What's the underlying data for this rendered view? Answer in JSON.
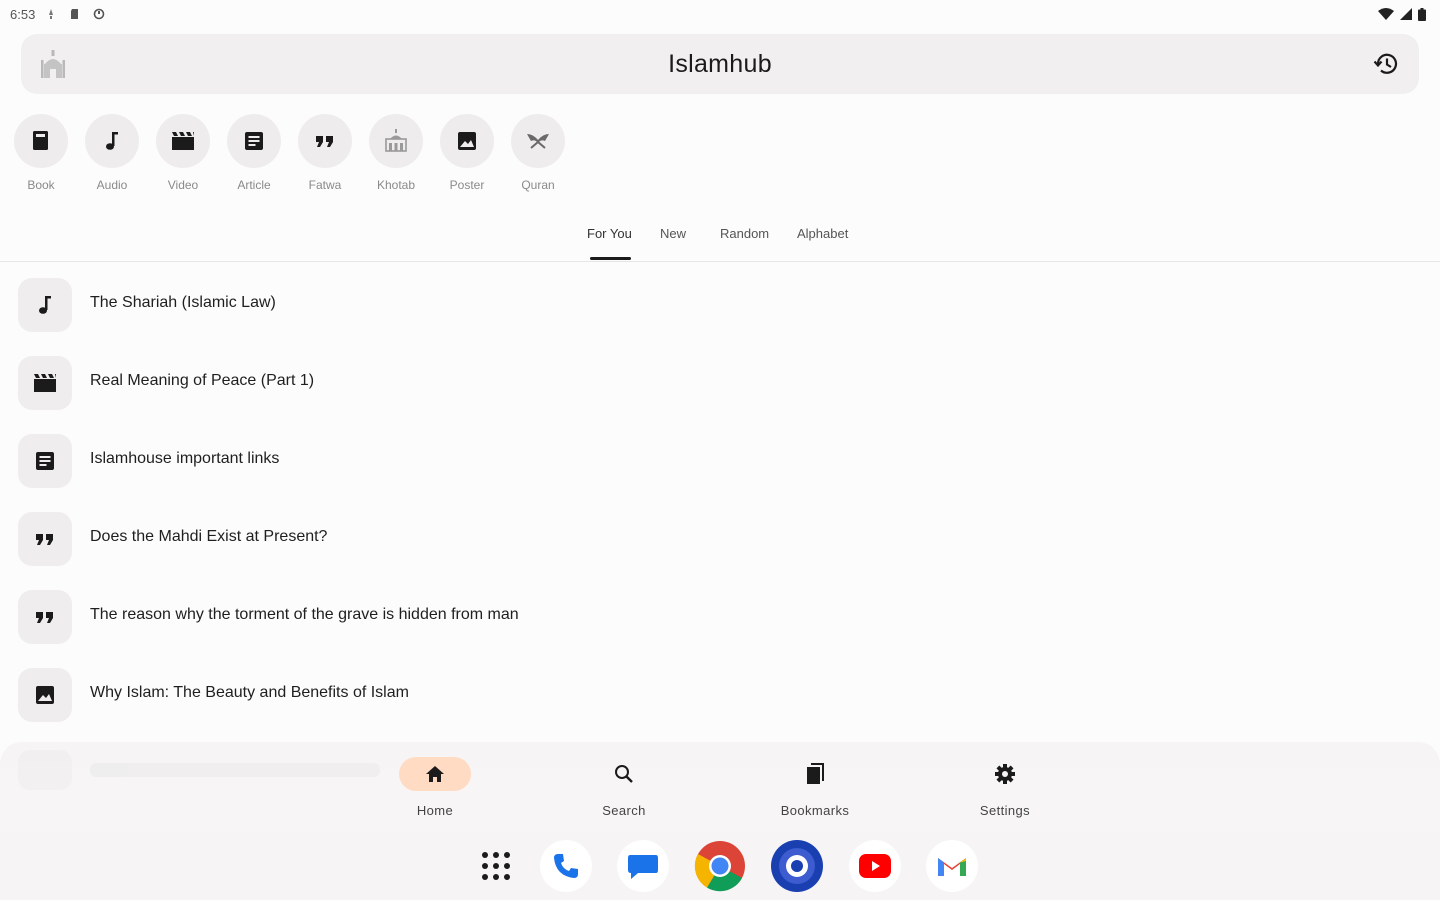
{
  "status_bar": {
    "time": "6:53"
  },
  "app_bar": {
    "title": "Islamhub"
  },
  "categories": [
    {
      "label": "Book",
      "icon": "book-icon"
    },
    {
      "label": "Audio",
      "icon": "music-note-icon"
    },
    {
      "label": "Video",
      "icon": "clapperboard-icon"
    },
    {
      "label": "Article",
      "icon": "article-icon"
    },
    {
      "label": "Fatwa",
      "icon": "quote-icon"
    },
    {
      "label": "Khotab",
      "icon": "mosque-icon"
    },
    {
      "label": "Poster",
      "icon": "image-icon"
    },
    {
      "label": "Quran",
      "icon": "quran-icon"
    }
  ],
  "tabs": [
    {
      "label": "For You",
      "active": true
    },
    {
      "label": "New",
      "active": false
    },
    {
      "label": "Random",
      "active": false
    },
    {
      "label": "Alphabet",
      "active": false
    }
  ],
  "items": [
    {
      "title": "The Shariah (Islamic Law)",
      "icon": "music-note-icon"
    },
    {
      "title": "Real Meaning of Peace (Part 1)",
      "icon": "clapperboard-icon"
    },
    {
      "title": "Islamhouse important links",
      "icon": "article-icon"
    },
    {
      "title": "Does the Mahdi Exist at Present?",
      "icon": "quote-icon"
    },
    {
      "title": "The reason why the torment of the grave is hidden from man",
      "icon": "quote-icon"
    },
    {
      "title": "Why Islam: The Beauty and Benefits of Islam",
      "icon": "image-icon"
    }
  ],
  "bottom_nav": [
    {
      "label": "Home",
      "icon": "home-icon",
      "active": true
    },
    {
      "label": "Search",
      "icon": "search-icon",
      "active": false
    },
    {
      "label": "Bookmarks",
      "icon": "bookmarks-icon",
      "active": false
    },
    {
      "label": "Settings",
      "icon": "gear-icon",
      "active": false
    }
  ],
  "dock_apps": [
    {
      "name": "app-drawer",
      "icon": "grid-icon"
    },
    {
      "name": "phone",
      "icon": "phone-icon"
    },
    {
      "name": "messages",
      "icon": "chat-icon"
    },
    {
      "name": "chrome",
      "icon": "chrome-icon"
    },
    {
      "name": "photos",
      "icon": "camera-icon"
    },
    {
      "name": "youtube",
      "icon": "youtube-icon"
    },
    {
      "name": "gmail",
      "icon": "gmail-icon"
    }
  ],
  "colors": {
    "accent_pill": "#ffdbc4",
    "surface": "#fdfcfc",
    "app_bar": "#f1efef"
  }
}
